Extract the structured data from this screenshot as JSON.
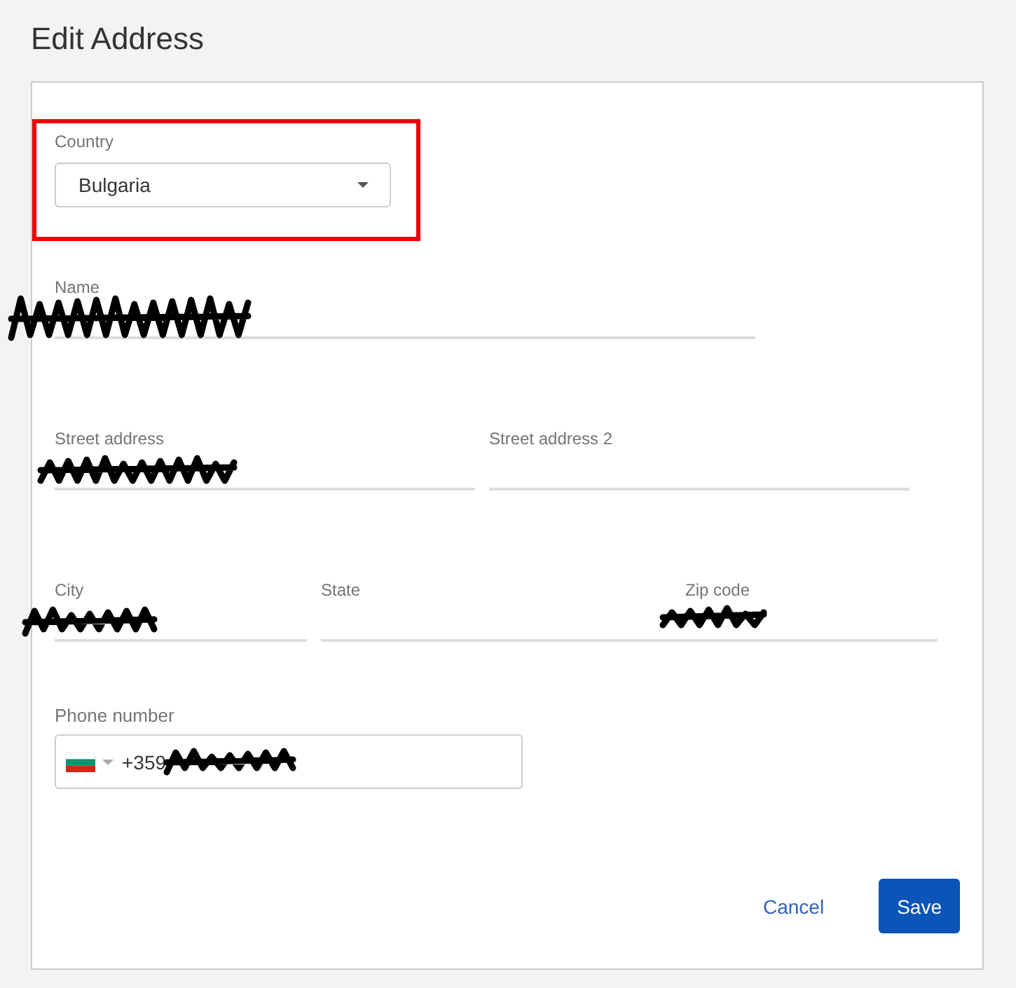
{
  "title": "Edit Address",
  "form": {
    "rows": [
      [
        {
          "kind": "select",
          "label": "Country",
          "value": "Bulgaria",
          "highlighted": true,
          "redacted": false
        }
      ],
      [
        {
          "kind": "text",
          "label": "Name",
          "highlighted": false,
          "redacted": true
        }
      ],
      [
        {
          "kind": "text",
          "label": "Street address",
          "highlighted": false,
          "redacted": true
        },
        {
          "kind": "text",
          "label": "Street address 2",
          "highlighted": false,
          "redacted": false
        }
      ],
      [
        {
          "kind": "text",
          "label": "City",
          "highlighted": false,
          "redacted": true
        },
        {
          "kind": "text",
          "label": "State",
          "highlighted": false,
          "redacted": false
        },
        {
          "kind": "text",
          "label": "Zip code",
          "highlighted": false,
          "redacted": true
        }
      ],
      [
        {
          "kind": "phone",
          "label": "Phone number",
          "value": "+359",
          "highlighted": false,
          "redacted": true
        }
      ]
    ],
    "actions": [
      {
        "kind": "link",
        "label": "Cancel"
      },
      {
        "kind": "primary",
        "label": "Save"
      }
    ]
  }
}
